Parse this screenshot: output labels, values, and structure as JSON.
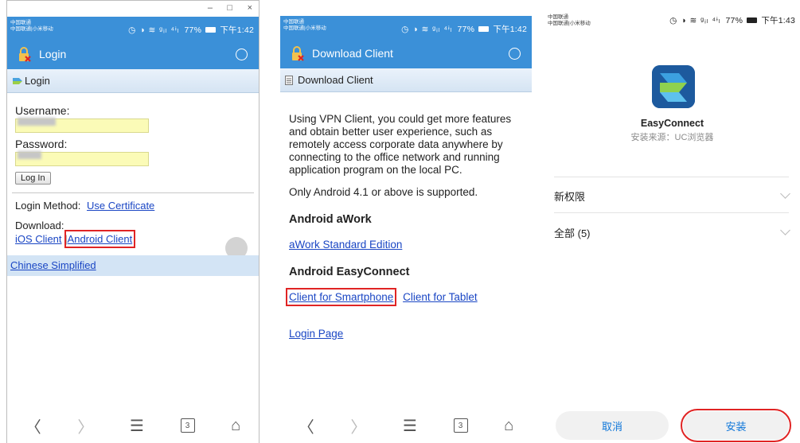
{
  "status": {
    "carrier_line1": "中国联通",
    "carrier_line2": "中国联通|小米移动",
    "icons": "◷ ◑ ≋ ᵍᵢₗ ⁴ᶤₗ",
    "battery": "77%",
    "time_1": "下午1:42",
    "time_2": "下午1:42",
    "time_3": "下午1:43"
  },
  "window_controls": {
    "minimize": "–",
    "maximize": "□",
    "close": "×"
  },
  "panel1": {
    "header_title": "Login",
    "subheader": "Login",
    "username_label": "Username:",
    "password_label": "Password:",
    "login_button": "Log In",
    "login_method_label": "Login Method:",
    "use_certificate": "Use Certificate",
    "download_label": "Download:",
    "ios_client": "iOS Client",
    "separator": "|",
    "android_client": "Android Client",
    "language": "Chinese Simplified"
  },
  "panel2": {
    "header_title": "Download Client",
    "subheader": "Download Client",
    "intro": "Using VPN Client, you could get more features and obtain better user experience, such as remotely access corporate data anywhere by connecting to the office network and running application program on the local PC.",
    "android_note": "Only Android 4.1 or above is supported.",
    "awork_heading": "Android aWork",
    "awork_link": "aWork Standard Edition",
    "ec_heading": "Android EasyConnect",
    "smartphone_link": "Client for Smartphone",
    "tablet_link": "Client for Tablet",
    "login_page_link": "Login Page"
  },
  "panel3": {
    "carrier_line1": "中国联通",
    "carrier_line2": "中国联通|小米移动",
    "app_name": "EasyConnect",
    "install_source": "安装来源：UC浏览器",
    "new_permissions": "新权限",
    "all_permissions": "全部 (5)",
    "cancel": "取消",
    "install": "安装"
  },
  "navbar": {
    "back": "〈",
    "forward": "〉",
    "menu": "☰",
    "tabs": "3",
    "home": "⌂"
  },
  "colors": {
    "header_blue": "#3b90d8",
    "highlight_red": "#e02424",
    "link_blue": "#1a46c4",
    "field_yellow": "#fbfbb7"
  },
  "icons": [
    "lock-icon",
    "refresh-icon",
    "login-icon",
    "document-icon",
    "app-icon",
    "chevron-down-icon",
    "back-icon",
    "forward-icon",
    "menu-icon",
    "tabs-icon",
    "home-icon"
  ]
}
